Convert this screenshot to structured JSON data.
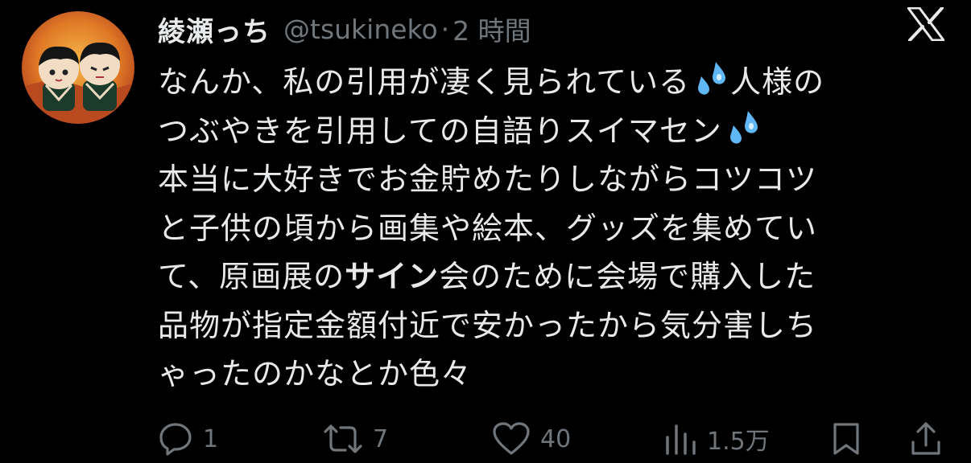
{
  "post": {
    "display_name": "綾瀬っち",
    "handle": "@tsukineko",
    "separator": "·",
    "time": "2 時間",
    "avatar_icon": "profile-avatar",
    "platform_icon": "x-logo-icon",
    "text_lines": [
      {
        "segments": [
          {
            "text": "なんか、私の引用が凄く見られている"
          },
          {
            "emoji": "sweat-droplets"
          },
          {
            "text": "人様の"
          }
        ]
      },
      {
        "segments": [
          {
            "text": "つぶやきを引用しての自語りスイマセン"
          },
          {
            "emoji": "sweat-droplets"
          }
        ]
      },
      {
        "segments": [
          {
            "text": "本当に大好きでお金貯めたりしながらコツコツ"
          }
        ]
      },
      {
        "segments": [
          {
            "text": "と子供の頃から画集や絵本、グッズを集めてい"
          }
        ]
      },
      {
        "segments": [
          {
            "text": "て、原画展の"
          },
          {
            "text": "サイン",
            "bold": true
          },
          {
            "text": "会のために会場で購入した"
          }
        ]
      },
      {
        "segments": [
          {
            "text": "品物が指定金額付近で安かったから気分害しち"
          }
        ]
      },
      {
        "segments": [
          {
            "text": "ゃったのかなとか色々"
          }
        ]
      }
    ]
  },
  "actions": {
    "reply": {
      "icon": "reply-icon",
      "count": "1"
    },
    "repost": {
      "icon": "repost-icon",
      "count": "7"
    },
    "like": {
      "icon": "heart-icon",
      "count": "40"
    },
    "views": {
      "icon": "views-icon",
      "count": "1.5万"
    },
    "bookmark": {
      "icon": "bookmark-icon"
    },
    "share": {
      "icon": "share-icon"
    }
  },
  "colors": {
    "background": "#000000",
    "text": "#e7e9ea",
    "muted": "#71767b",
    "emoji_blue": "#5fb8f5"
  }
}
